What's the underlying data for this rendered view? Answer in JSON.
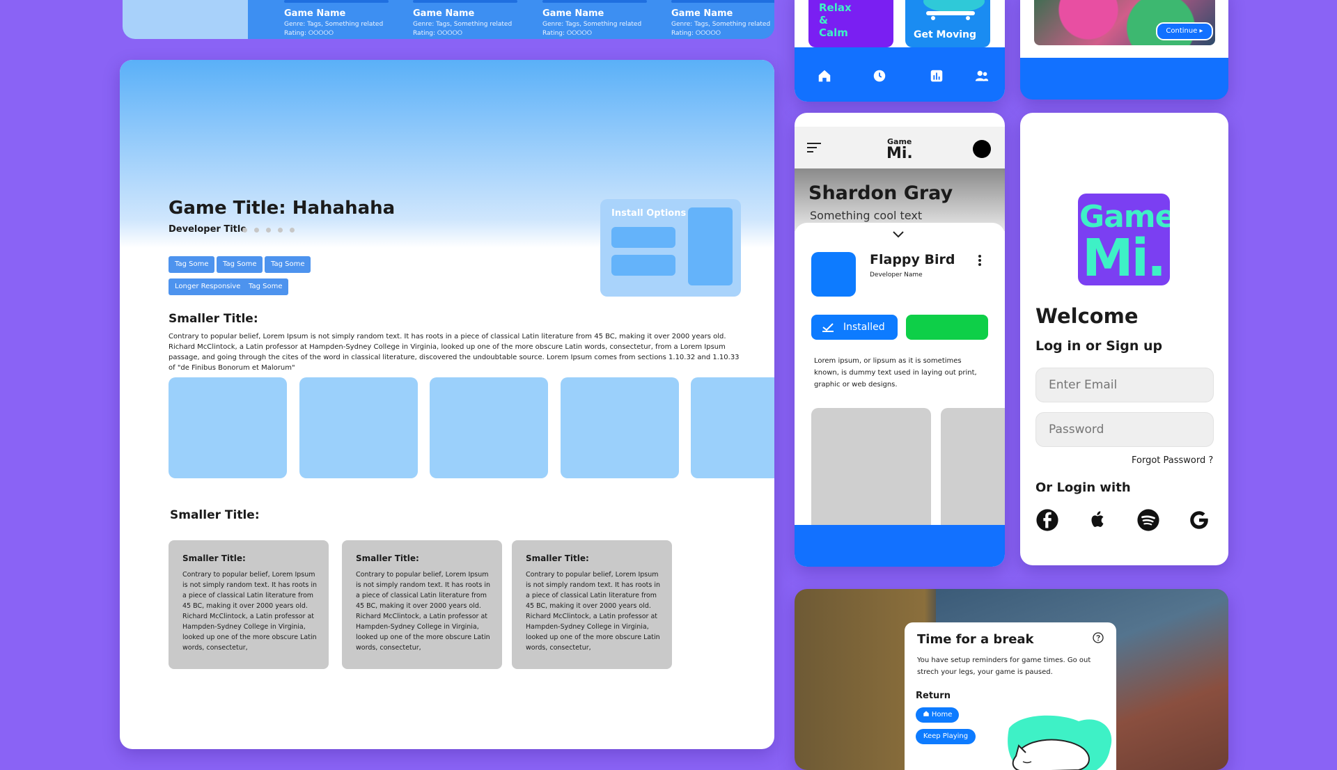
{
  "colors": {
    "background": "#8a63f5",
    "primary": "#1271ff",
    "accent": "#3ef1c6",
    "purple": "#7b3ff2",
    "green": "#0ecf48"
  },
  "top_strip": {
    "items": [
      {
        "name": "Game Name",
        "meta": "Genre: Tags, Something related",
        "rating": "Rating: ⭘⭘⭘⭘⭘"
      },
      {
        "name": "Game Name",
        "meta": "Genre: Tags, Something related",
        "rating": "Rating: ⭘⭘⭘⭘⭘"
      },
      {
        "name": "Game Name",
        "meta": "Genre: Tags, Something related",
        "rating": "Rating: ⭘⭘⭘⭘⭘"
      },
      {
        "name": "Game Name",
        "meta": "Genre: Tags, Something related",
        "rating": "Rating: ⭘⭘⭘⭘⭘"
      }
    ]
  },
  "main": {
    "title": "Game Title: Hahahaha",
    "developer": "Developer Title",
    "tags": [
      "Tag Some",
      "Tag Some",
      "Tag Some",
      "Longer Responsive",
      "Tag Some"
    ],
    "install_label": "Install Options",
    "section1_title": "Smaller Title:",
    "description": "Contrary to popular belief, Lorem Ipsum is not simply random text. It has roots in a piece of classical Latin literature from 45 BC, making it over 2000 years old. Richard McClintock, a Latin professor at Hampden-Sydney College in Virginia, looked up one of the more obscure Latin words, consectetur, from a Lorem Ipsum passage, and going through the cites of the word in classical literature, discovered the undoubtable source. Lorem Ipsum comes from sections 1.10.32 and 1.10.33 of \"de Finibus Bonorum et Malorum\"",
    "section2_title": "Smaller Title:",
    "cards": [
      {
        "title": "Smaller Title:",
        "body": "Contrary to popular belief, Lorem Ipsum is not simply random text. It has roots in a piece of classical Latin literature from 45 BC, making it over 2000 years old. Richard McClintock, a Latin professor at Hampden-Sydney College in Virginia, looked up one of the more obscure Latin words, consectetur,"
      },
      {
        "title": "Smaller Title:",
        "body": "Contrary to popular belief, Lorem Ipsum is not simply random text. It has roots in a piece of classical Latin literature from 45 BC, making it over 2000 years old. Richard McClintock, a Latin professor at Hampden-Sydney College in Virginia, looked up one of the more obscure Latin words, consectetur,"
      },
      {
        "title": "Smaller Title:",
        "body": "Contrary to popular belief, Lorem Ipsum is not simply random text. It has roots in a piece of classical Latin literature from 45 BC, making it over 2000 years old. Richard McClintock, a Latin professor at Hampden-Sydney College in Virginia, looked up one of the more obscure Latin words, consectetur,"
      }
    ]
  },
  "mobile_home": {
    "tiles": [
      {
        "label_lines": [
          "Relax",
          "&",
          "Calm"
        ]
      },
      {
        "label": "Get Moving"
      }
    ],
    "nav_icons": [
      "home-icon",
      "clock-icon",
      "chart-icon",
      "friends-icon"
    ]
  },
  "game_card": {
    "continue_label": "Continue"
  },
  "app_detail": {
    "logo_small": "Game",
    "logo_big": "Mi.",
    "profile_name": "Shardon Gray",
    "profile_sub": "Something cool text",
    "app_name": "Flappy Bird",
    "developer": "Developer Name",
    "installed_label": "Installed",
    "description": "Lorem ipsum, or lipsum as it is sometimes known, is dummy text used in laying out print, graphic or web designs."
  },
  "login": {
    "logo_top": "Game",
    "logo_bottom": "Mi.",
    "welcome": "Welcome",
    "subtitle": "Log in or Sign up",
    "email_placeholder": "Enter Email",
    "password_placeholder": "Password",
    "forgot": "Forgot Password ?",
    "or_login": "Or Login with",
    "providers": [
      "facebook-icon",
      "apple-icon",
      "spotify-icon",
      "google-icon"
    ]
  },
  "break_popup": {
    "title": "Time for a break",
    "description": "You have setup reminders for game times. Go out strech your legs, your game is paused.",
    "return_label": "Return",
    "home_label": "Home",
    "keep_playing_label": "Keep Playing"
  }
}
